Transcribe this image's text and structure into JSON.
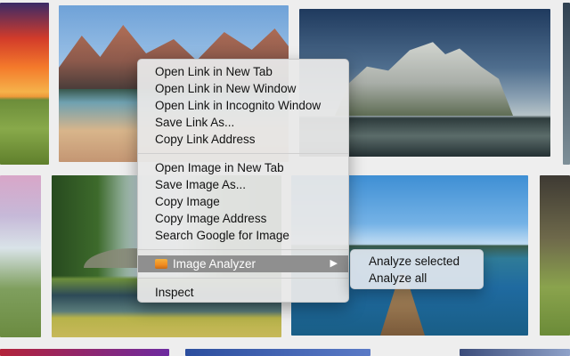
{
  "context_menu": {
    "link_items": [
      "Open Link in New Tab",
      "Open Link in New Window",
      "Open Link in Incognito Window",
      "Save Link As...",
      "Copy Link Address"
    ],
    "image_items": [
      "Open Image in New Tab",
      "Save Image As...",
      "Copy Image",
      "Copy Image Address",
      "Search Google for Image"
    ],
    "extension_item": {
      "label": "Image Analyzer",
      "icon": "image-icon",
      "arrow": "▶"
    },
    "inspect": "Inspect"
  },
  "submenu": {
    "items": [
      "Analyze selected",
      "Analyze all"
    ]
  },
  "colors": {
    "menu_bg": "#e8e8e8",
    "highlight": "#8f8f8f",
    "submenu_bg": "#dce4ec",
    "icon_orange": "#f08c20"
  }
}
